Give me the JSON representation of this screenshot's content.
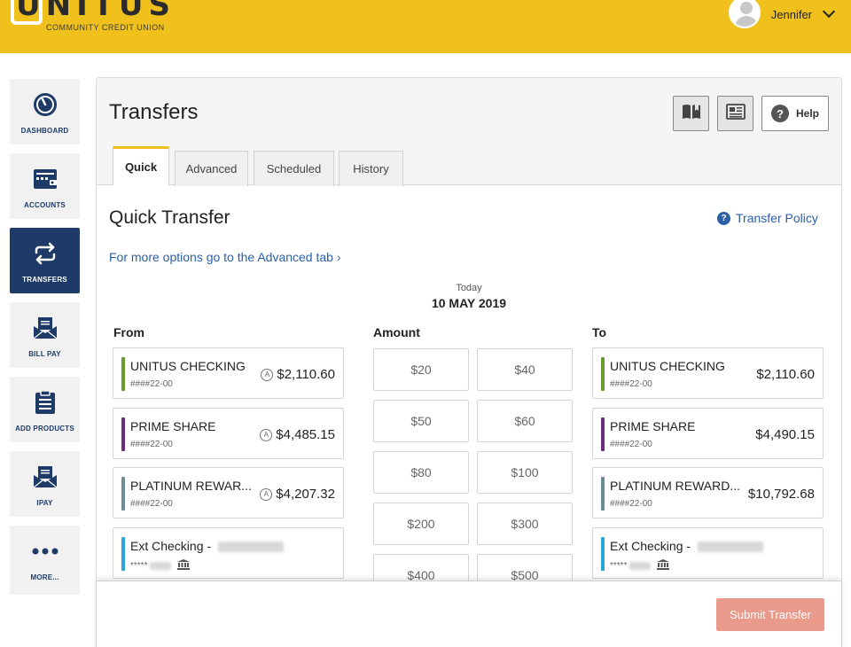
{
  "header": {
    "logo_text": "UNITUS",
    "logo_subtitle": "COMMUNITY CREDIT UNION",
    "user_name": "Jennifer"
  },
  "sidebar": {
    "items": [
      {
        "label": "DASHBOARD",
        "icon": "gauge-icon",
        "active": false
      },
      {
        "label": "ACCOUNTS",
        "icon": "wallet-icon",
        "active": false
      },
      {
        "label": "TRANSFERS",
        "icon": "transfer-arrows-icon",
        "active": true
      },
      {
        "label": "BILL PAY",
        "icon": "envelope-icon",
        "active": false
      },
      {
        "label": "ADD PRODUCTS",
        "icon": "clipboard-icon",
        "active": false
      },
      {
        "label": "IPAY",
        "icon": "envelope-icon",
        "active": false
      },
      {
        "label": "MORE...",
        "icon": "more-dots-icon",
        "active": false
      }
    ]
  },
  "page": {
    "title": "Transfers",
    "help_label": "Help",
    "tabs": [
      {
        "label": "Quick",
        "active": true
      },
      {
        "label": "Advanced",
        "active": false
      },
      {
        "label": "Scheduled",
        "active": false
      },
      {
        "label": "History",
        "active": false
      }
    ]
  },
  "quick": {
    "title": "Quick Transfer",
    "policy_link": "Transfer Policy",
    "advanced_link": "For more options go to the Advanced tab ›",
    "today_label": "Today",
    "date": "10 MAY 2019",
    "from_label": "From",
    "amount_label": "Amount",
    "to_label": "To"
  },
  "from_accounts": [
    {
      "name": "UNITUS CHECKING",
      "number": "####22-00",
      "balance": "$2,110.60",
      "badge": "A",
      "color": "#6a9a2e"
    },
    {
      "name": "PRIME SHARE",
      "number": "####22-00",
      "balance": "$4,485.15",
      "badge": "A",
      "color": "#6b2f7a"
    },
    {
      "name": "PLATINUM REWAR...",
      "number": "####22-00",
      "balance": "$4,207.32",
      "badge": "A",
      "color": "#6e8e94"
    },
    {
      "name": "Ext Checking -",
      "number": "*****",
      "balance": "",
      "badge": "",
      "color": "#29a8d8"
    }
  ],
  "to_accounts": [
    {
      "name": "UNITUS CHECKING",
      "number": "####22-00",
      "balance": "$2,110.60",
      "color": "#6a9a2e"
    },
    {
      "name": "PRIME SHARE",
      "number": "####22-00",
      "balance": "$4,490.15",
      "color": "#6b2f7a"
    },
    {
      "name": "PLATINUM REWARD...",
      "number": "####22-00",
      "balance": "$10,792.68",
      "color": "#6e8e94"
    },
    {
      "name": "Ext Checking -",
      "number": "*****",
      "balance": "",
      "color": "#29a8d8"
    }
  ],
  "amounts": [
    "$20",
    "$40",
    "$50",
    "$60",
    "$80",
    "$100",
    "$200",
    "$300",
    "$400",
    "$500"
  ],
  "footer": {
    "submit_label": "Submit Transfer"
  },
  "colors": {
    "brand_yellow": "#f0c11c",
    "nav_blue": "#1e3a66",
    "link_blue": "#2b5fa8",
    "submit_disabled": "#ea9a8a"
  }
}
